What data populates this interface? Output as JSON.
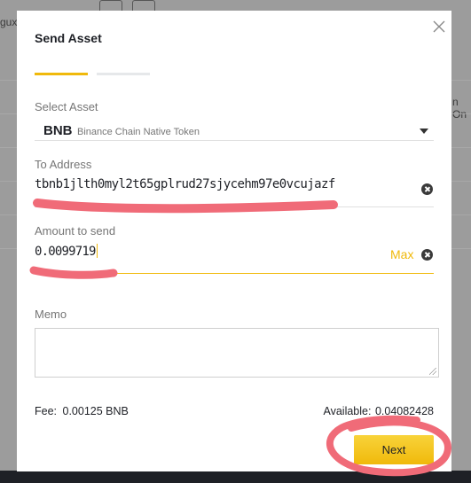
{
  "background": {
    "left_text": "gux",
    "right_text": "n On"
  },
  "modal": {
    "title": "Send Asset",
    "asset": {
      "label": "Select Asset",
      "symbol": "BNB",
      "name": "Binance Chain Native Token"
    },
    "to_address": {
      "label": "To Address",
      "value": "tbnb1jlth0myl2t65gplrud27sjycehm97e0vcujazf"
    },
    "amount": {
      "label": "Amount to send",
      "value": "0.0099719",
      "max_label": "Max"
    },
    "memo": {
      "label": "Memo",
      "value": ""
    },
    "fee": {
      "label": "Fee:",
      "value": "0.00125 BNB"
    },
    "available": {
      "label": "Available:",
      "value": "0.04082428"
    },
    "next_label": "Next",
    "step": {
      "current": 1,
      "total": 2
    }
  },
  "colors": {
    "accent": "#f0b90b",
    "annotation": "#f06b78",
    "overlay": "#9c9c9c"
  },
  "icons": [
    "close-icon",
    "chevron-down-icon",
    "clear-icon"
  ]
}
